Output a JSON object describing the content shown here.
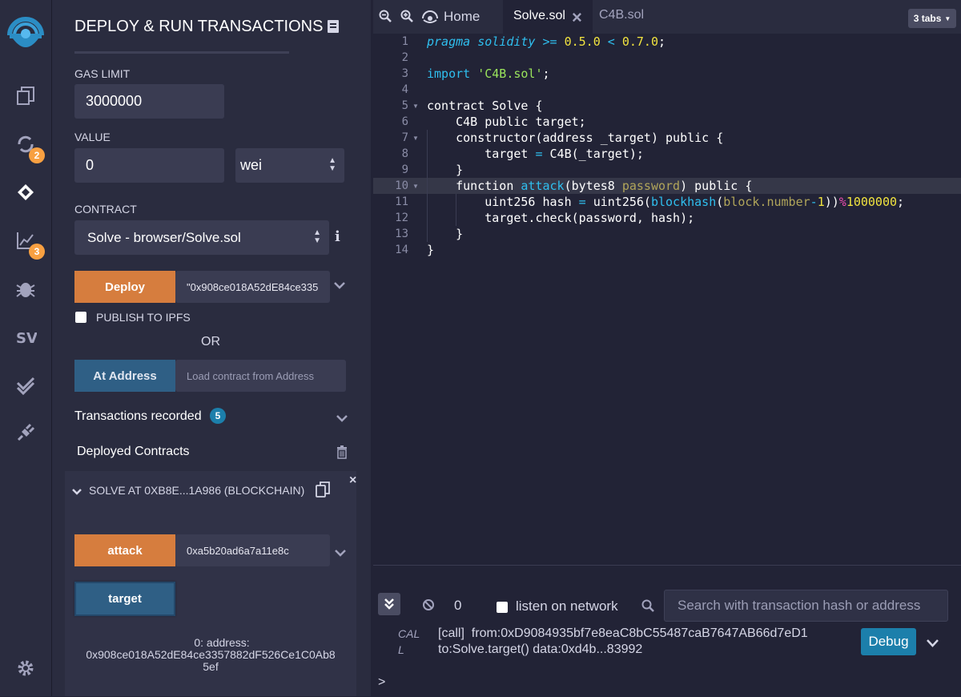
{
  "iconbar": {
    "badges": {
      "compiler": "2",
      "analysis": "3"
    }
  },
  "panel": {
    "title": "DEPLOY & RUN TRANSACTIONS",
    "gas_limit_label": "GAS LIMIT",
    "gas_limit_value": "3000000",
    "value_label": "VALUE",
    "value_value": "0",
    "value_unit": "wei",
    "contract_label": "CONTRACT",
    "contract_selected": "Solve - browser/Solve.sol",
    "deploy_label": "Deploy",
    "deploy_arg": "\"0x908ce018A52dE84ce335",
    "publish_ipfs_label": "PUBLISH TO IPFS",
    "or_label": "OR",
    "at_address_label": "At Address",
    "at_address_placeholder": "Load contract from Address",
    "transactions_label": "Transactions recorded",
    "transactions_count": "5",
    "deployed_label": "Deployed Contracts",
    "instance_title": "SOLVE AT 0XB8E...1A986 (BLOCKCHAIN)",
    "attack_label": "attack",
    "attack_arg": "0xa5b20ad6a7a11e8c",
    "target_label": "target",
    "target_result_line1": "0: address:",
    "target_result_line2": "0x908ce018A52dE84ce3357882dF526Ce1C0Ab8",
    "target_result_line3": "5ef"
  },
  "editor": {
    "home_tab": "Home",
    "tabs": [
      "Solve.sol",
      "C4B.sol"
    ],
    "tabs_count": "3 tabs",
    "line_numbers": [
      "1",
      "2",
      "3",
      "4",
      "5",
      "6",
      "7",
      "8",
      "9",
      "10",
      "11",
      "12",
      "13",
      "14"
    ]
  },
  "terminal": {
    "count": "0",
    "listen_label": "listen on network",
    "search_placeholder": "Search with transaction hash or address",
    "log_type_1": "CAL",
    "log_type_2": "L",
    "log_line1": "[call]  from:0xD9084935bf7e8eaC8bC55487caB7647AB66d7eD1",
    "log_line2": "to:Solve.target() data:0xd4b...83992",
    "debug_label": "Debug",
    "prompt": ">"
  },
  "colors": {
    "accent_orange": "#d67d3e",
    "accent_blue": "#1c7fab",
    "sidebar_bg": "#2a2c3f",
    "main_bg": "#222336"
  }
}
